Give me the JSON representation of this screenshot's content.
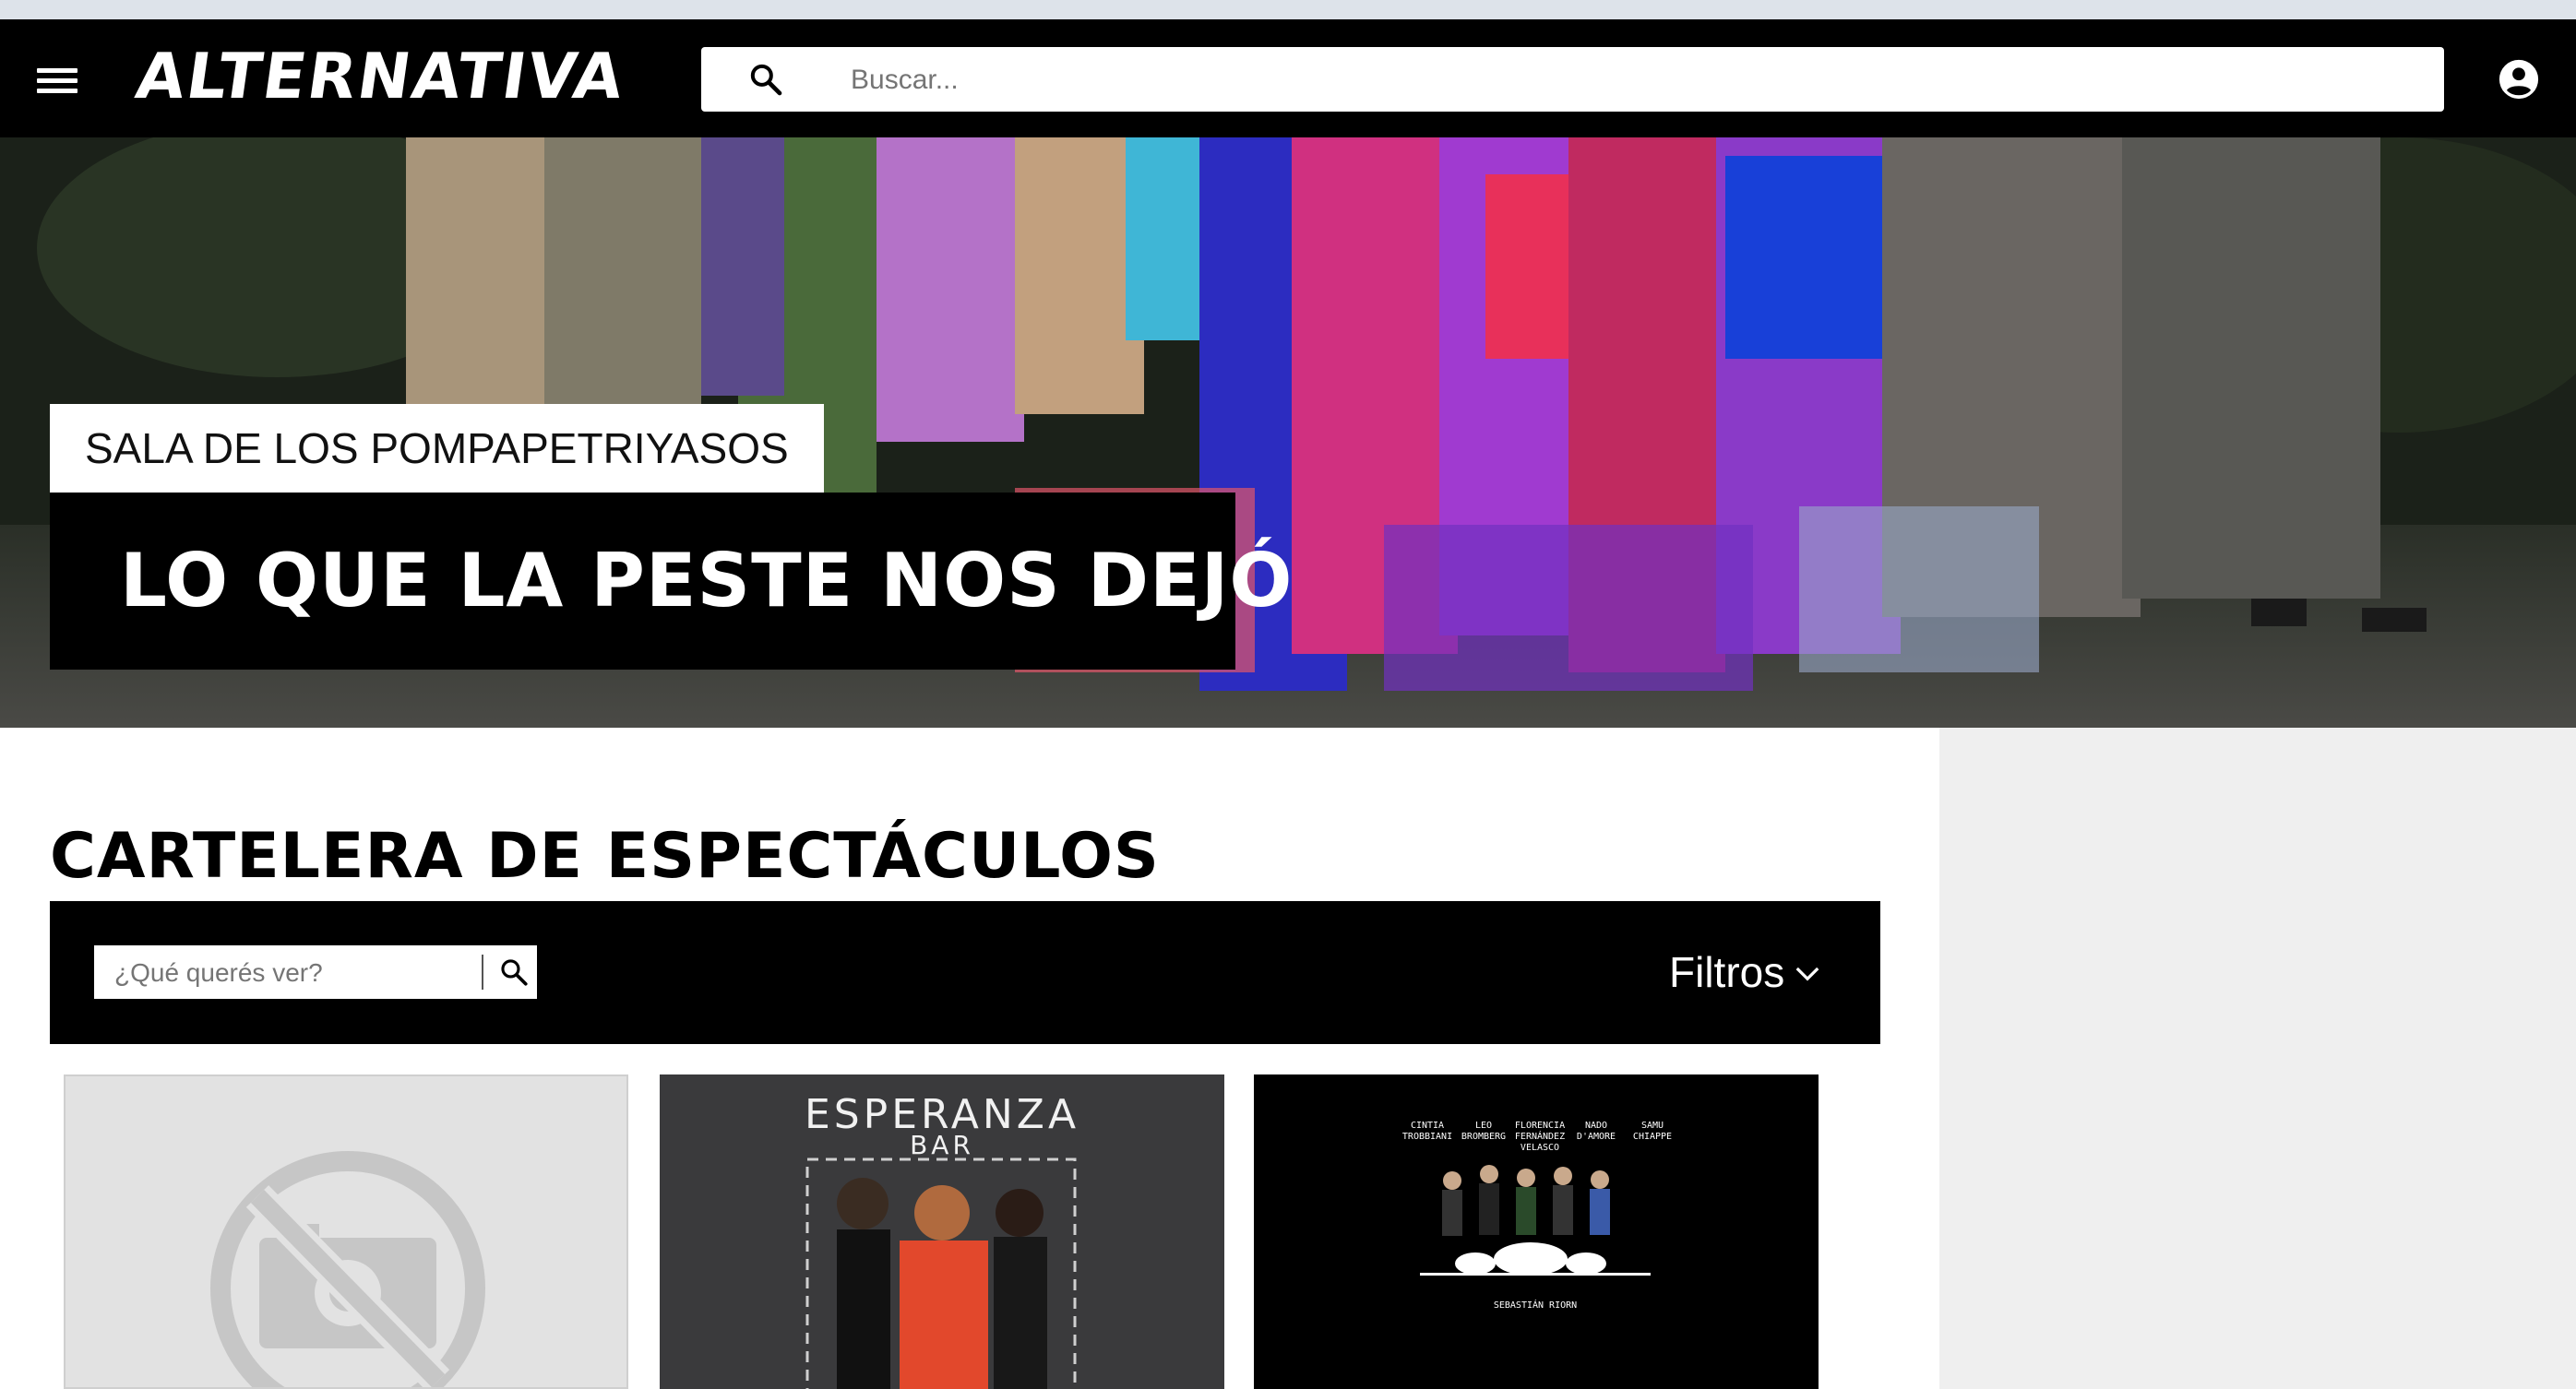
{
  "header": {
    "menu_icon": "hamburger-menu-icon",
    "logo_text": "ALTERNATIVA",
    "search": {
      "placeholder": "Buscar...",
      "value": ""
    },
    "account_icon": "account-circle-icon"
  },
  "hero": {
    "venue": "SALA DE LOS POMPAPETRIYASOS",
    "title": "LO QUE LA PESTE NOS DEJÓ"
  },
  "main": {
    "page_title": "CARTELERA DE ESPECTÁCULOS",
    "filter": {
      "search_placeholder": "¿Qué querés ver?",
      "search_value": "",
      "filters_label": "Filtros"
    },
    "cards": [
      {
        "image": "no-photo-placeholder-icon"
      },
      {
        "art_title": "ESPERANZA",
        "art_subtitle": "BAR"
      },
      {
        "credits": [
          "CINTIA TROBBIANI",
          "LEO BROMBERG",
          "FLORENCIA FERNÁNDEZ VELASCO",
          "NADO D'AMORE",
          "SAMU CHIAPPE"
        ],
        "credit_bottom": "SEBASTIÁN RIORN"
      }
    ]
  },
  "colors": {
    "navbar": "#000000",
    "sidebar": "#efefef",
    "accent_text": "#ffffff"
  }
}
